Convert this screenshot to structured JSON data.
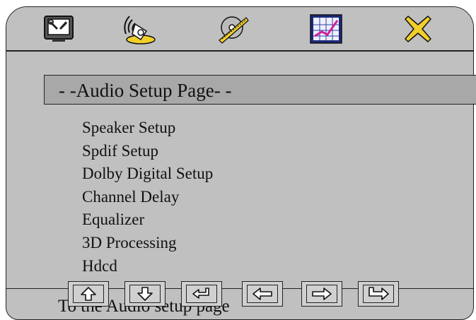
{
  "tabs": [
    {
      "name": "general-setup",
      "icon": "tv-tools-icon"
    },
    {
      "name": "audio-setup",
      "icon": "speaker-sound-icon"
    },
    {
      "name": "dolby-setup",
      "icon": "disc-film-icon"
    },
    {
      "name": "video-setup",
      "icon": "graph-chart-icon"
    },
    {
      "name": "exit",
      "icon": "close-x-icon"
    }
  ],
  "page": {
    "title": "- -Audio Setup Page- -"
  },
  "menu": {
    "items": [
      "Speaker Setup",
      "Spdif Setup",
      "Dolby Digital Setup",
      "Channel Delay",
      "Equalizer",
      "3D Processing",
      "Hdcd"
    ]
  },
  "status": {
    "text": "To the Audio setup page"
  },
  "nav_buttons": [
    {
      "name": "up",
      "icon": "arrow-up-icon"
    },
    {
      "name": "down",
      "icon": "arrow-down-icon"
    },
    {
      "name": "enter",
      "icon": "enter-return-icon"
    },
    {
      "name": "left",
      "icon": "arrow-left-icon"
    },
    {
      "name": "right",
      "icon": "arrow-right-icon"
    },
    {
      "name": "jump",
      "icon": "jump-arrow-icon"
    }
  ],
  "colors": {
    "background": "#c0c0c0",
    "title_bar": "#a8a8a8",
    "accent_yellow": "#f2cf2a"
  }
}
